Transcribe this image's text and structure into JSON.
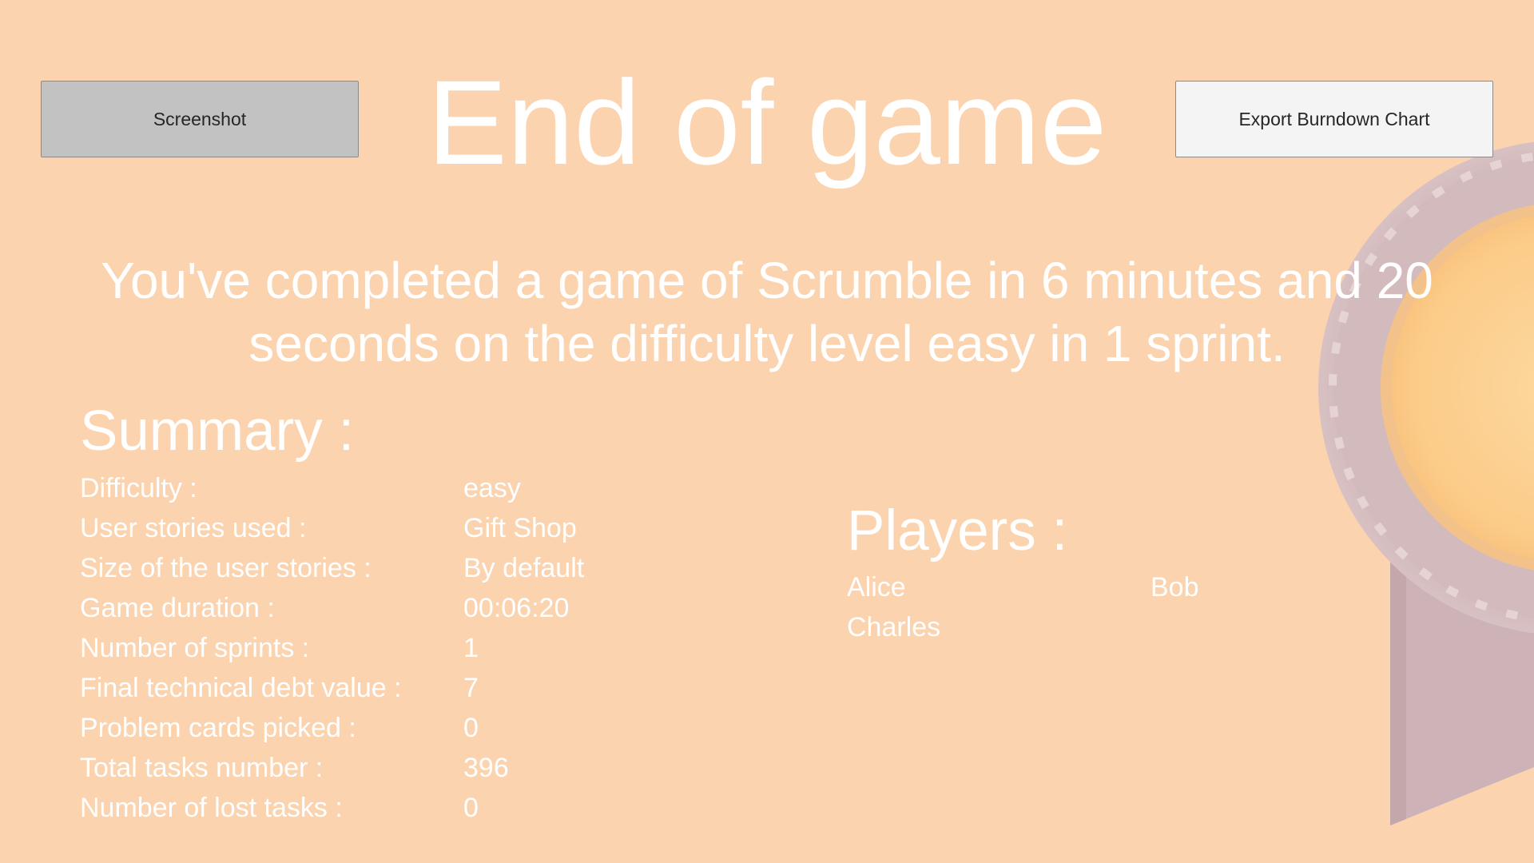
{
  "title": "End of game",
  "buttons": {
    "screenshot": "Screenshot",
    "export": "Export Burndown Chart"
  },
  "completion_message": "You've completed a game of Scrumble in 6 minutes and 20 seconds on the difficulty level easy in 1 sprint.",
  "summary": {
    "heading": "Summary :",
    "rows": [
      {
        "label": "Difficulty :",
        "value": "easy"
      },
      {
        "label": "User stories used :",
        "value": "Gift Shop"
      },
      {
        "label": "Size of the user stories :",
        "value": "By default"
      },
      {
        "label": "Game duration :",
        "value": "00:06:20"
      },
      {
        "label": "Number of sprints :",
        "value": "1"
      },
      {
        "label": "Final technical debt value :",
        "value": "7"
      },
      {
        "label": "Problem cards picked :",
        "value": "0"
      },
      {
        "label": "Total tasks number :",
        "value": "396"
      },
      {
        "label": "Number of lost tasks :",
        "value": "0"
      }
    ]
  },
  "players": {
    "heading": "Players :",
    "names": [
      "Alice",
      "Bob",
      "Charles"
    ]
  },
  "colors": {
    "background": "#fbd3af",
    "text": "#ffffff",
    "medal_ribbon": "#cdb3b7",
    "medal_gold": "#fcd49a"
  },
  "decoration": {
    "medal": "award-medal-icon"
  }
}
